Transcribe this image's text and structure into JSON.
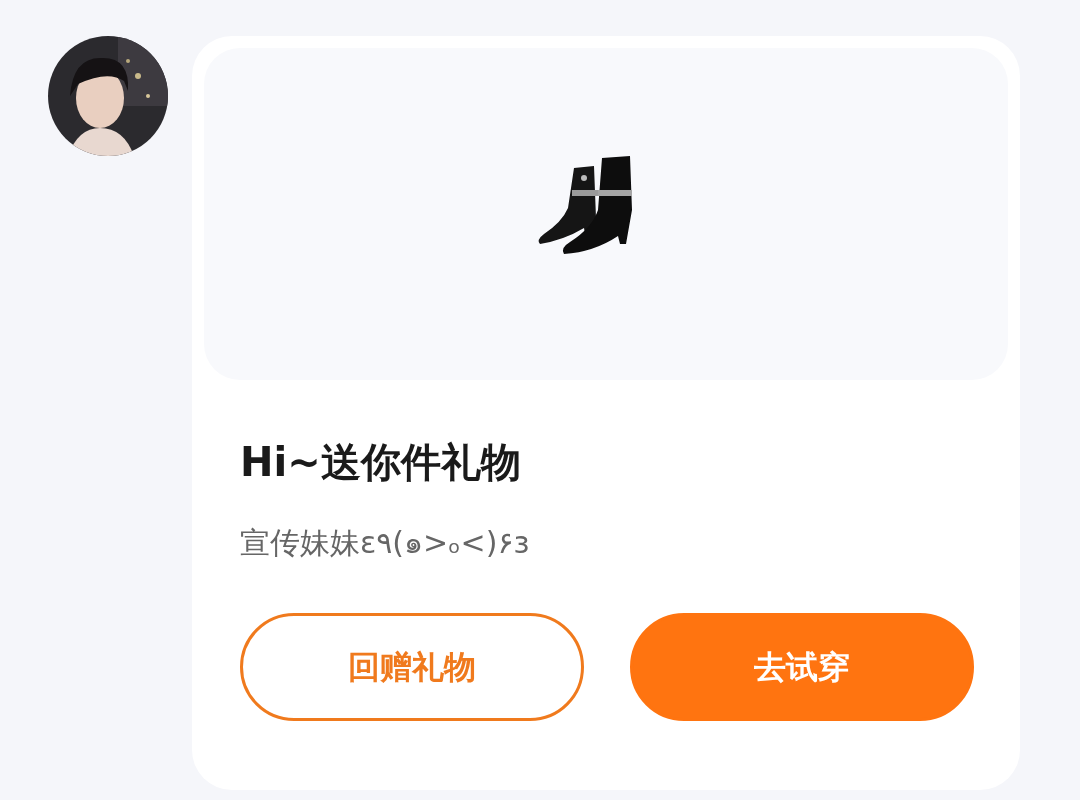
{
  "card": {
    "title": "Hi~送你件礼物",
    "subtitle": "宣传妹妹ε٩(๑>ₒ<)۶з",
    "buttons": [
      {
        "label": "回赠礼物",
        "kind": "outline"
      },
      {
        "label": "去试穿",
        "kind": "filled"
      }
    ]
  }
}
